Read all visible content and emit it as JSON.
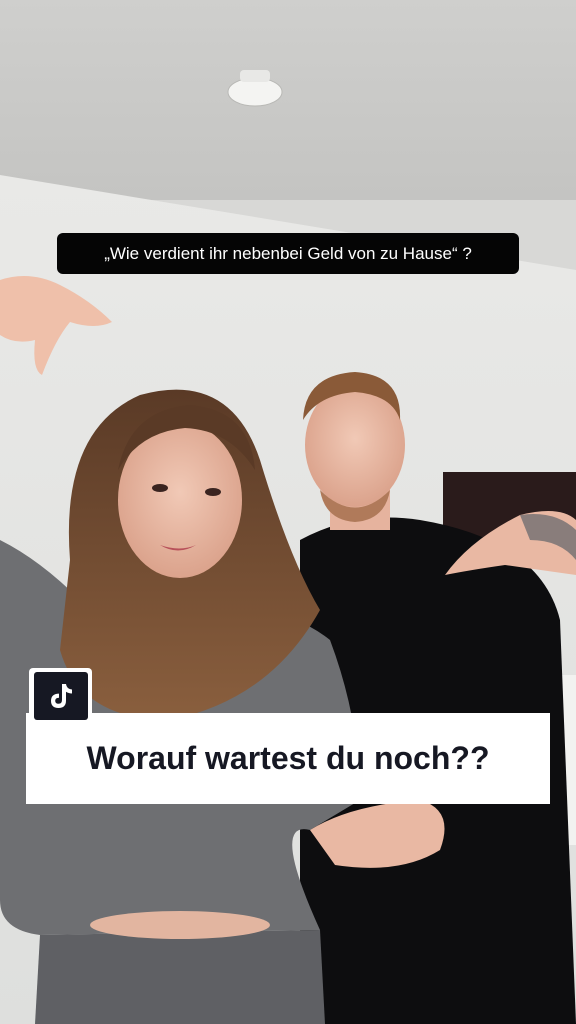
{
  "video": {
    "top_caption": "„Wie verdient ihr nebenbei Geld von zu Hause“ ?",
    "banner_text": "Worauf wartest du noch??",
    "badge_icon": "tiktok-logo-icon"
  },
  "colors": {
    "caption_bg": "#050505",
    "banner_bg": "#ffffff",
    "banner_text": "#161823",
    "badge_dark": "#161823"
  }
}
